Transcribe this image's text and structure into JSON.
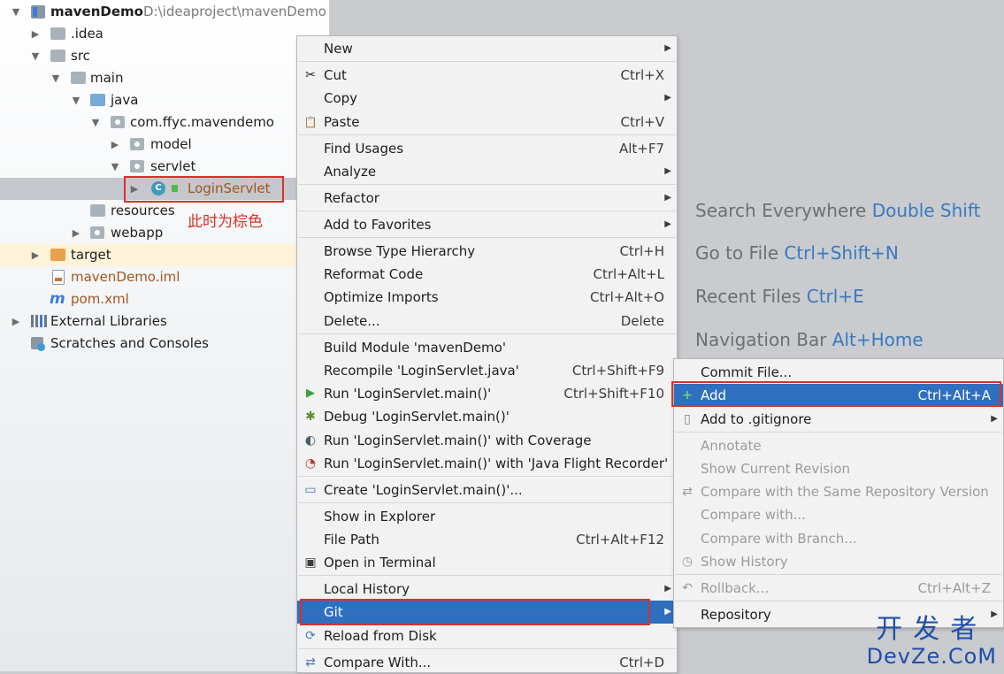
{
  "tree": {
    "project_name": "mavenDemo",
    "project_path": "D:\\ideaproject\\mavenDemo",
    "items": [
      {
        "label": "mavenDemo"
      },
      {
        "label": ".idea"
      },
      {
        "label": "src"
      },
      {
        "label": "main"
      },
      {
        "label": "java"
      },
      {
        "label": "com.ffyc.mavendemo"
      },
      {
        "label": "model"
      },
      {
        "label": "servlet"
      },
      {
        "label": "LoginServlet"
      },
      {
        "label": "resources"
      },
      {
        "label": "webapp"
      },
      {
        "label": "target"
      },
      {
        "label": "mavenDemo.iml"
      },
      {
        "label": "pom.xml"
      },
      {
        "label": "External Libraries"
      },
      {
        "label": "Scratches and Consoles"
      }
    ],
    "class_badge": "C",
    "maven_glyph": "m"
  },
  "annotation": "此时为棕色",
  "hints": [
    {
      "text": "Search Everywhere",
      "key": "Double Shift"
    },
    {
      "text": "Go to File",
      "key": "Ctrl+Shift+N"
    },
    {
      "text": "Recent Files",
      "key": "Ctrl+E"
    },
    {
      "text": "Navigation Bar",
      "key": "Alt+Home"
    }
  ],
  "context_menu": {
    "items": [
      {
        "label": "New",
        "shortcut": "",
        "submenu": "▶"
      },
      {
        "label": "Cut",
        "shortcut": "Ctrl+X",
        "icon": "✂"
      },
      {
        "label": "Copy",
        "shortcut": "",
        "submenu": "▶"
      },
      {
        "label": "Paste",
        "shortcut": "Ctrl+V",
        "icon": "📋"
      },
      {
        "label": "Find Usages",
        "shortcut": "Alt+F7"
      },
      {
        "label": "Analyze",
        "shortcut": "",
        "submenu": "▶"
      },
      {
        "label": "Refactor",
        "shortcut": "",
        "submenu": "▶"
      },
      {
        "label": "Add to Favorites",
        "shortcut": "",
        "submenu": "▶"
      },
      {
        "label": "Browse Type Hierarchy",
        "shortcut": "Ctrl+H"
      },
      {
        "label": "Reformat Code",
        "shortcut": "Ctrl+Alt+L"
      },
      {
        "label": "Optimize Imports",
        "shortcut": "Ctrl+Alt+O"
      },
      {
        "label": "Delete...",
        "shortcut": "Delete"
      },
      {
        "label": "Build Module 'mavenDemo'",
        "shortcut": ""
      },
      {
        "label": "Recompile 'LoginServlet.java'",
        "shortcut": "Ctrl+Shift+F9"
      },
      {
        "label": "Run 'LoginServlet.main()'",
        "shortcut": "Ctrl+Shift+F10",
        "icon": "▶"
      },
      {
        "label": "Debug 'LoginServlet.main()'",
        "shortcut": "",
        "icon": "✱"
      },
      {
        "label": "Run 'LoginServlet.main()' with Coverage",
        "shortcut": "",
        "icon": "◐"
      },
      {
        "label": "Run 'LoginServlet.main()' with 'Java Flight Recorder'",
        "shortcut": "",
        "icon": "◔"
      },
      {
        "label": "Create 'LoginServlet.main()'...",
        "shortcut": "",
        "icon": "▭"
      },
      {
        "label": "Show in Explorer",
        "shortcut": ""
      },
      {
        "label": "File Path",
        "shortcut": "Ctrl+Alt+F12"
      },
      {
        "label": "Open in Terminal",
        "shortcut": "",
        "icon": "▣"
      },
      {
        "label": "Local History",
        "shortcut": "",
        "submenu": "▶"
      },
      {
        "label": "Git",
        "shortcut": "",
        "submenu": "▶"
      },
      {
        "label": "Reload from Disk",
        "shortcut": "",
        "icon": "⟳"
      },
      {
        "label": "Compare With...",
        "shortcut": "Ctrl+D",
        "icon": "⇄"
      }
    ]
  },
  "git_menu": {
    "items": [
      {
        "label": "Commit File...",
        "shortcut": ""
      },
      {
        "label": "Add",
        "shortcut": "Ctrl+Alt+A",
        "icon": "+"
      },
      {
        "label": "Add to .gitignore",
        "shortcut": "",
        "submenu": "▶",
        "icon": "▯"
      },
      {
        "label": "Annotate",
        "shortcut": ""
      },
      {
        "label": "Show Current Revision",
        "shortcut": ""
      },
      {
        "label": "Compare with the Same Repository Version",
        "shortcut": "",
        "icon": "⇄"
      },
      {
        "label": "Compare with...",
        "shortcut": ""
      },
      {
        "label": "Compare with Branch...",
        "shortcut": ""
      },
      {
        "label": "Show History",
        "shortcut": "",
        "icon": "◷"
      },
      {
        "label": "Rollback...",
        "shortcut": "Ctrl+Alt+Z",
        "icon": "↶"
      },
      {
        "label": "Repository",
        "shortcut": "",
        "submenu": "▶"
      }
    ]
  },
  "watermark": {
    "cn": "开发者",
    "en": "DevZe.CoM"
  },
  "colors": {
    "accent": "#2f6fc0",
    "annotation_red": "#d8312c",
    "unversioned_brown": "#a4551f",
    "shortcut_blue": "#3979c0"
  }
}
